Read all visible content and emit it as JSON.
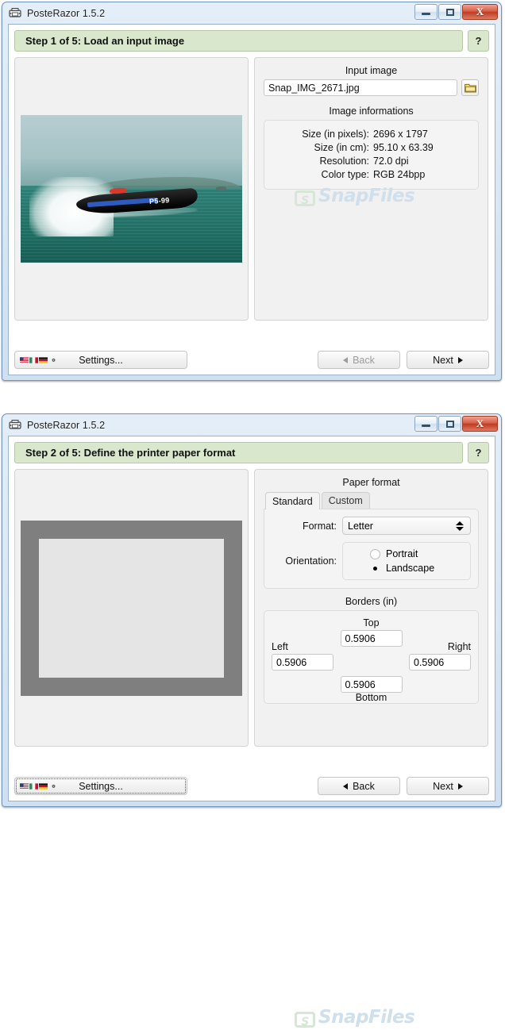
{
  "app": {
    "title": "PosteRazor 1.5.2",
    "icon": "printer-icon"
  },
  "window_controls": {
    "minimize": "minimize-icon",
    "maximize": "maximize-icon",
    "close": "X"
  },
  "watermark": {
    "badge": "S",
    "text": "SnapFiles"
  },
  "step1": {
    "header": "Step 1 of 5: Load an input image",
    "help": "?",
    "input_image": {
      "group_label": "Input image",
      "filename": "Snap_IMG_2671.jpg",
      "browse_icon": "folder-icon"
    },
    "image_info": {
      "group_label": "Image informations",
      "rows": [
        {
          "key": "Size (in pixels):",
          "value": "2696 x 1797"
        },
        {
          "key": "Size (in cm):",
          "value": "95.10 x 63.39"
        },
        {
          "key": "Resolution:",
          "value": "72.0 dpi"
        },
        {
          "key": "Color type:",
          "value": "RGB 24bpp"
        }
      ]
    },
    "footer": {
      "settings": "Settings...",
      "back": "Back",
      "next": "Next",
      "back_enabled": false
    }
  },
  "step2": {
    "header": "Step 2 of 5: Define the printer paper format",
    "help": "?",
    "paper_format": {
      "group_label": "Paper format",
      "tabs": [
        {
          "label": "Standard",
          "active": true
        },
        {
          "label": "Custom",
          "active": false
        }
      ],
      "format_label": "Format:",
      "format_value": "Letter",
      "orientation_label": "Orientation:",
      "orientation_options": [
        {
          "label": "Portrait",
          "selected": false
        },
        {
          "label": "Landscape",
          "selected": true
        }
      ]
    },
    "borders": {
      "group_label": "Borders (in)",
      "top_label": "Top",
      "top_value": "0.5906",
      "left_label": "Left",
      "left_value": "0.5906",
      "right_label": "Right",
      "right_value": "0.5906",
      "bottom_label": "Bottom",
      "bottom_value": "0.5906"
    },
    "footer": {
      "settings": "Settings...",
      "back": "Back",
      "next": "Next",
      "back_enabled": true
    }
  }
}
